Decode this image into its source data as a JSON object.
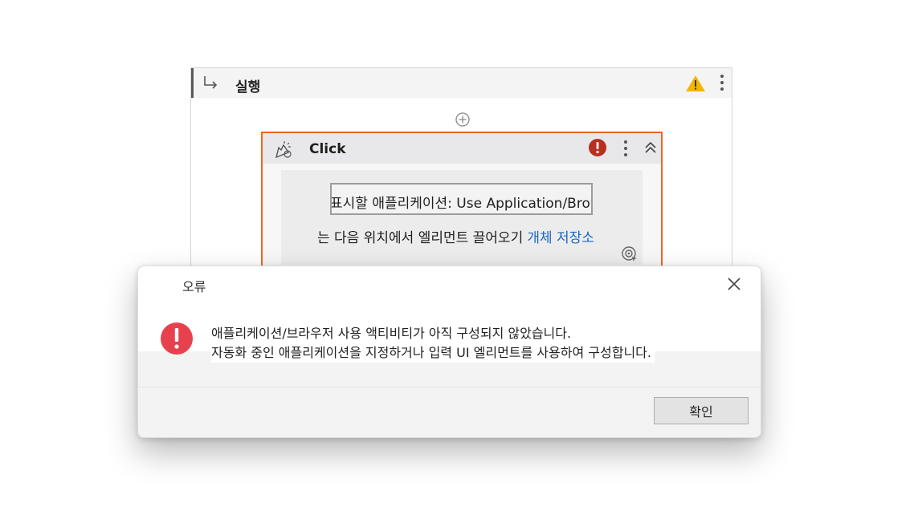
{
  "sequence": {
    "title": "실행",
    "icons": {
      "arrow": "return-arrow-icon",
      "warning": "warning-icon",
      "more": "more-vertical-icon",
      "add": "add-circle-icon"
    }
  },
  "click_action": {
    "title": "Click",
    "app_field_value": "표시할 애플리케이션:  Use Application/Browser",
    "drag_text": "는 다음 위치에서 엘리먼트 끌어오기",
    "object_repo_link": "개체 저장소",
    "icons": {
      "action": "click-action-icon",
      "error": "error-badge-icon",
      "more": "more-vertical-icon",
      "collapse": "collapse-chevron-icon",
      "target": "target-element-icon"
    }
  },
  "dialog": {
    "title": "오류",
    "message_line1": "애플리케이션/브라우저 사용 액티비티가 아직 구성되지 않았습니다.",
    "message_line2": "자동화 중인 애플리케이션을 지정하거나 입력 UI 엘리먼트를 사용하여 구성합니다.",
    "ok_label": "확인",
    "icons": {
      "error": "error-icon",
      "close": "close-icon"
    }
  },
  "colors": {
    "accent_orange": "#f26522",
    "error_red": "#e8414e",
    "error_badge": "#b5301f",
    "warning_yellow": "#f5b400",
    "link_blue": "#1a66c9"
  }
}
